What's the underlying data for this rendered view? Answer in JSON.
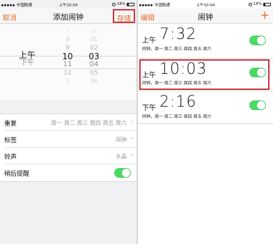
{
  "status": {
    "carrier": "中国联通",
    "time": "上午10:04",
    "battery": "18%"
  },
  "left": {
    "nav": {
      "cancel": "取消",
      "title": "添加闹钟",
      "save": "存储"
    },
    "picker": {
      "ampm": [
        "上午",
        "下午"
      ],
      "hours": [
        "7",
        "8",
        "9",
        "10",
        "11",
        "12",
        "1"
      ],
      "minutes": [
        "00",
        "01",
        "02",
        "03",
        "04",
        "05",
        "06"
      ]
    },
    "settings": [
      {
        "label": "重复",
        "value": "周一 周二 周三 周四 周五 周六"
      },
      {
        "label": "标签",
        "value": "闹钟"
      },
      {
        "label": "铃声",
        "value": "水晶"
      },
      {
        "label": "稍后提醒",
        "toggle": true
      }
    ]
  },
  "right": {
    "nav": {
      "edit": "编辑",
      "title": "闹钟",
      "add": "+"
    },
    "alarms": [
      {
        "ampm": "上午",
        "time": "7:32",
        "sub": "闹钟，周一 周二 周三 周四 周五 周六",
        "on": true
      },
      {
        "ampm": "上午",
        "time": "10:03",
        "sub": "闹钟，周一 周二 周三 周四 周五 周六",
        "on": true
      },
      {
        "ampm": "下午",
        "time": "2:16",
        "sub": "闹钟，周一 周二 周三 周四 周五 周六",
        "on": true
      }
    ]
  },
  "colors": {
    "accent": "#e86b2c",
    "toggle_on": "#4cd964",
    "highlight": "#c7343c"
  }
}
